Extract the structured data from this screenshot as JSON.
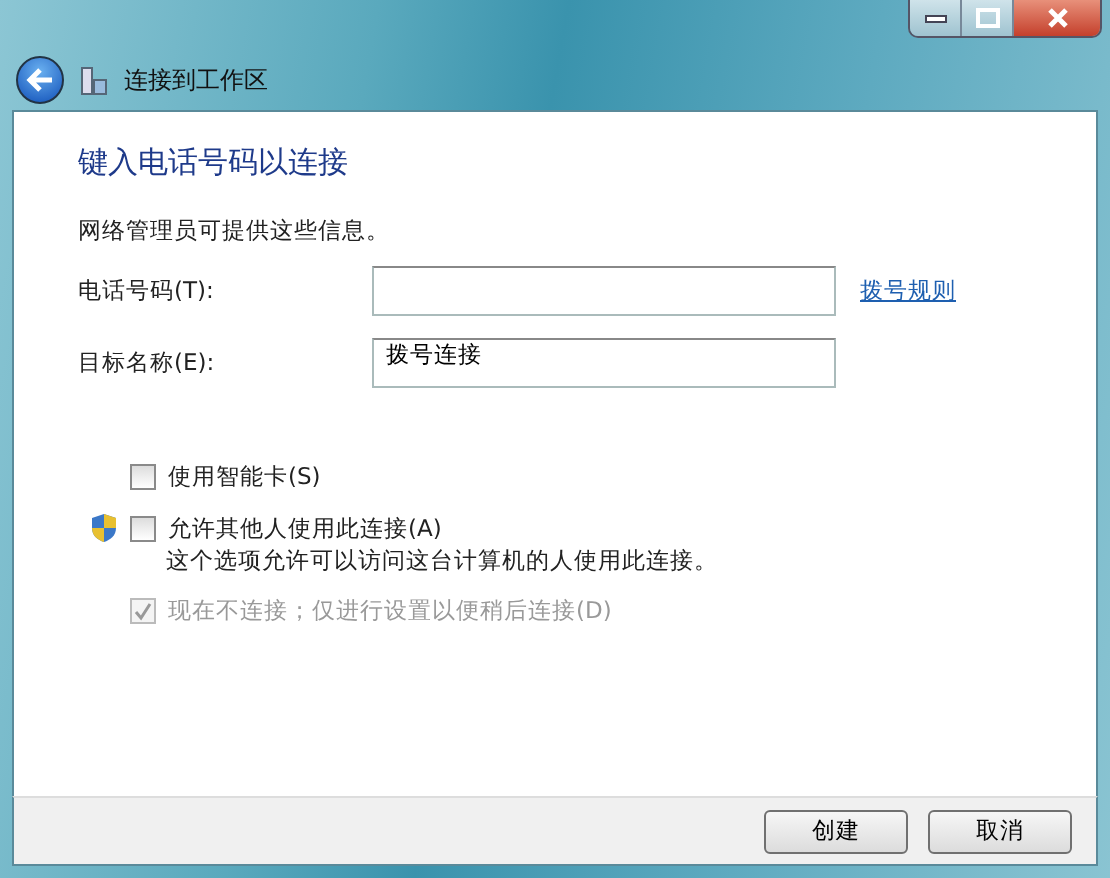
{
  "window": {
    "title": "连接到工作区"
  },
  "heading": "键入电话号码以连接",
  "intro": "网络管理员可提供这些信息。",
  "fields": [
    {
      "label": "电话号码(T):",
      "link": "拨号规则"
    },
    {
      "label": "目标名称(E):",
      "value": "拨号连接"
    }
  ],
  "options": [
    {
      "label": "使用智能卡(S)",
      "checked": false,
      "disabled": false,
      "shield": false
    },
    {
      "label": "允许其他人使用此连接(A)",
      "checked": false,
      "disabled": false,
      "shield": true,
      "note": "这个选项允许可以访问这台计算机的人使用此连接。"
    },
    {
      "label": "现在不连接；仅进行设置以便稍后连接(D)",
      "checked": true,
      "disabled": true,
      "shield": false
    }
  ],
  "buttons": [
    "创建",
    "取消"
  ]
}
